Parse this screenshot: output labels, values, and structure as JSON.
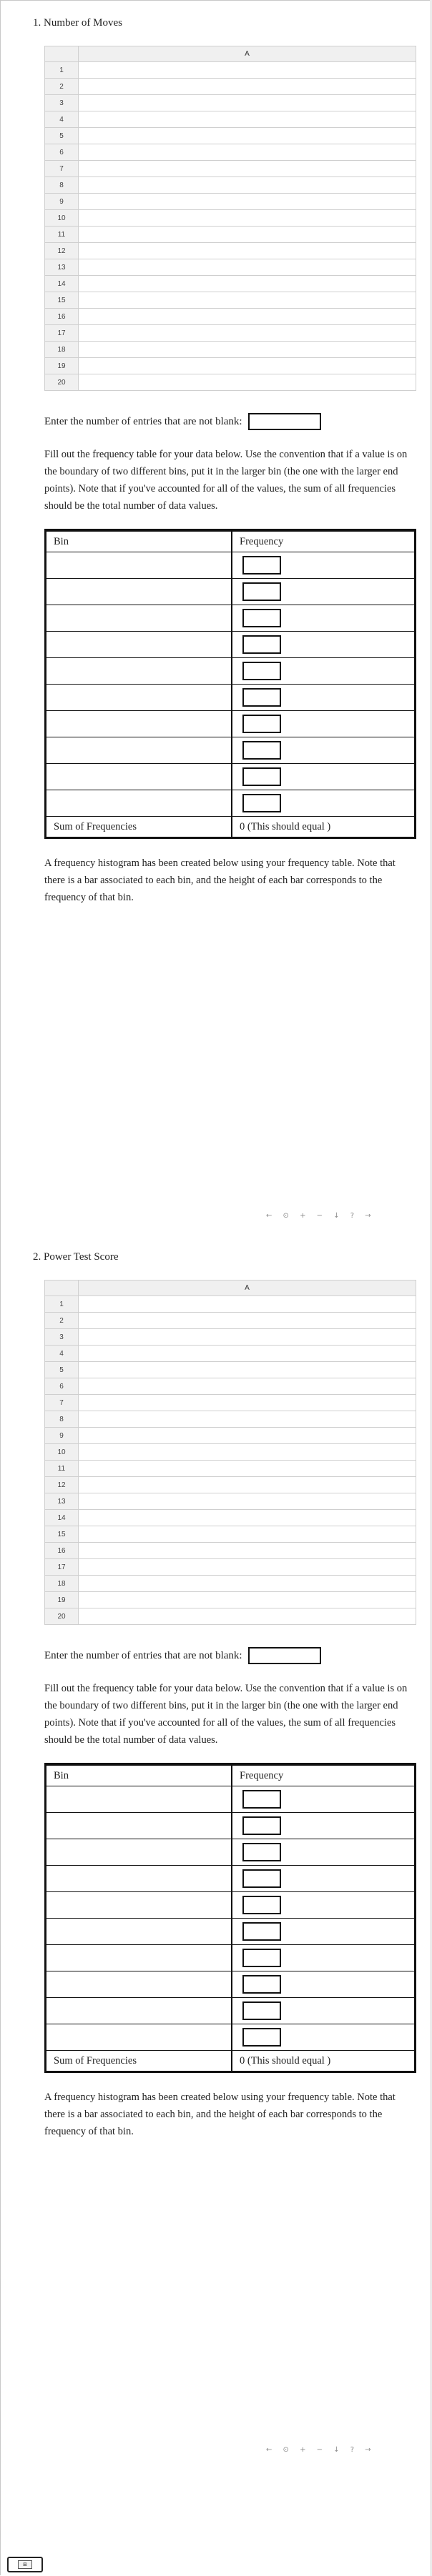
{
  "questions": [
    {
      "title": "1. Number of Moves",
      "sheet": {
        "column_header": "A",
        "row_labels": [
          "1",
          "2",
          "3",
          "4",
          "5",
          "6",
          "7",
          "8",
          "9",
          "10",
          "11",
          "12",
          "13",
          "14",
          "15",
          "16",
          "17",
          "18",
          "19",
          "20"
        ]
      },
      "count_prompt": "Enter the number of entries that are not blank:",
      "count_value": "",
      "instructions": "Fill out the frequency table for your data below. Use the convention that if a value is on the boundary of two different bins, put it in the larger bin (the one with the larger end points). Note that if you've accounted for all of the values, the sum of all frequencies should be the total number of data values.",
      "table": {
        "bin_header": "Bin",
        "frequency_header": "Frequency",
        "row_count": 10,
        "sum_label": "Sum of Frequencies",
        "sum_value": "0 (This should equal )"
      },
      "histogram_note": "A frequency histogram has been created below using your frequency table. Note that there is a bar associated to each bin, and the height of each bar corresponds to the frequency of that bin.",
      "graph_tools": "← ⊙ + − ↓ ? →"
    },
    {
      "title": "2. Power Test Score",
      "sheet": {
        "column_header": "A",
        "row_labels": [
          "1",
          "2",
          "3",
          "4",
          "5",
          "6",
          "7",
          "8",
          "9",
          "10",
          "11",
          "12",
          "13",
          "14",
          "15",
          "16",
          "17",
          "18",
          "19",
          "20"
        ]
      },
      "count_prompt": "Enter the number of entries that are not blank:",
      "count_value": "",
      "instructions": "Fill out the frequency table for your data below. Use the convention that if a value is on the boundary of two different bins, put it in the larger bin (the one with the larger end points). Note that if you've accounted for all of the values, the sum of all frequencies should be the total number of data values.",
      "table": {
        "bin_header": "Bin",
        "frequency_header": "Frequency",
        "row_count": 10,
        "sum_label": "Sum of Frequencies",
        "sum_value": "0 (This should equal )"
      },
      "histogram_note": "A frequency histogram has been created below using your frequency table. Note that there is a bar associated to each bin, and the height of each bar corresponds to the frequency of that bin.",
      "graph_tools": "← ⊙ + − ↓ ? →"
    }
  ],
  "bottom_button_label": "⊞"
}
